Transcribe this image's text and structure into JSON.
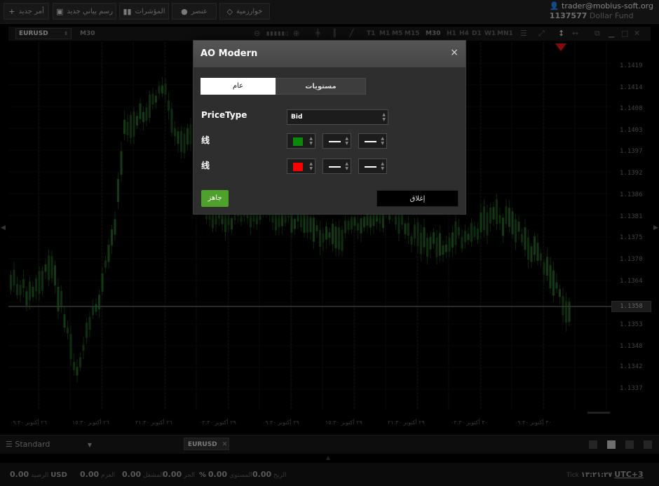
{
  "toolbar": {
    "new_order": "أمر جديد",
    "new_chart": "رسم بياني جديد",
    "indicators": "المؤشرات",
    "element": "عنصر",
    "algorithm": "خوارزمية"
  },
  "account": {
    "email": "trader@mobius-soft.org",
    "number": "1137577",
    "fund": "Dollar Fund"
  },
  "chart": {
    "symbol": "EURUSD",
    "timeframe": "M30",
    "timeframes": [
      "T1",
      "M1",
      "M5",
      "M15",
      "M30",
      "H1",
      "H4",
      "D1",
      "W1",
      "MN1"
    ],
    "current_price": "1.1358",
    "price_labels": [
      "1.1419",
      "1.1414",
      "1.1408",
      "1.1403",
      "1.1397",
      "1.1392",
      "1.1386",
      "1.1381",
      "1.1375",
      "1.1370",
      "1.1364",
      "1.1353",
      "1.1348",
      "1.1342",
      "1.1337"
    ],
    "time_labels": [
      "٢٦ أكتوبر ٠٩:٣٠",
      "٢٦ أكتوبر ١٥:٣٠",
      "٢٦ أكتوبر ٢١:٣٠",
      "٢٩ أكتوبر ٠٣:٣٠",
      "٢٩ أكتوبر ٠٩:٣٠",
      "٢٩ أكتوبر ١٥:٣٠",
      "٢٩ أكتوبر ٢١:٣٠",
      "٣٠ أكتوبر ٠٣:٣٠",
      "٣٠ أكتوبر ٠٩:٣٠"
    ]
  },
  "bottom": {
    "layout": "Standard",
    "tab": "EURUSD"
  },
  "status": {
    "balance_label": "الرصيد",
    "balance_value": "0.00",
    "currency": "USD",
    "equity_label": "العزم",
    "equity_value": "0.00",
    "margin_label": "المشغل",
    "margin_value": "0.00",
    "free_label": "الحر",
    "free_value": "0.00",
    "level_label": "المستوى",
    "level_value": "%",
    "profit_label": "الربح",
    "profit_value": "0.00",
    "tick_label": "Tick",
    "clock": "١٣:٢١:٢٧",
    "utc": "UTC+3"
  },
  "dialog": {
    "title": "AO Modern",
    "close_icon": "×",
    "tab_general": "عام",
    "tab_levels": "مستويات",
    "price_type_label": "PriceType",
    "price_type_value": "Bid",
    "line1_label": "线",
    "line2_label": "线",
    "line1_color": "#0a8a0a",
    "line2_color": "#ff0000",
    "ok_label": "جاهز",
    "close_label": "إغلاق"
  }
}
